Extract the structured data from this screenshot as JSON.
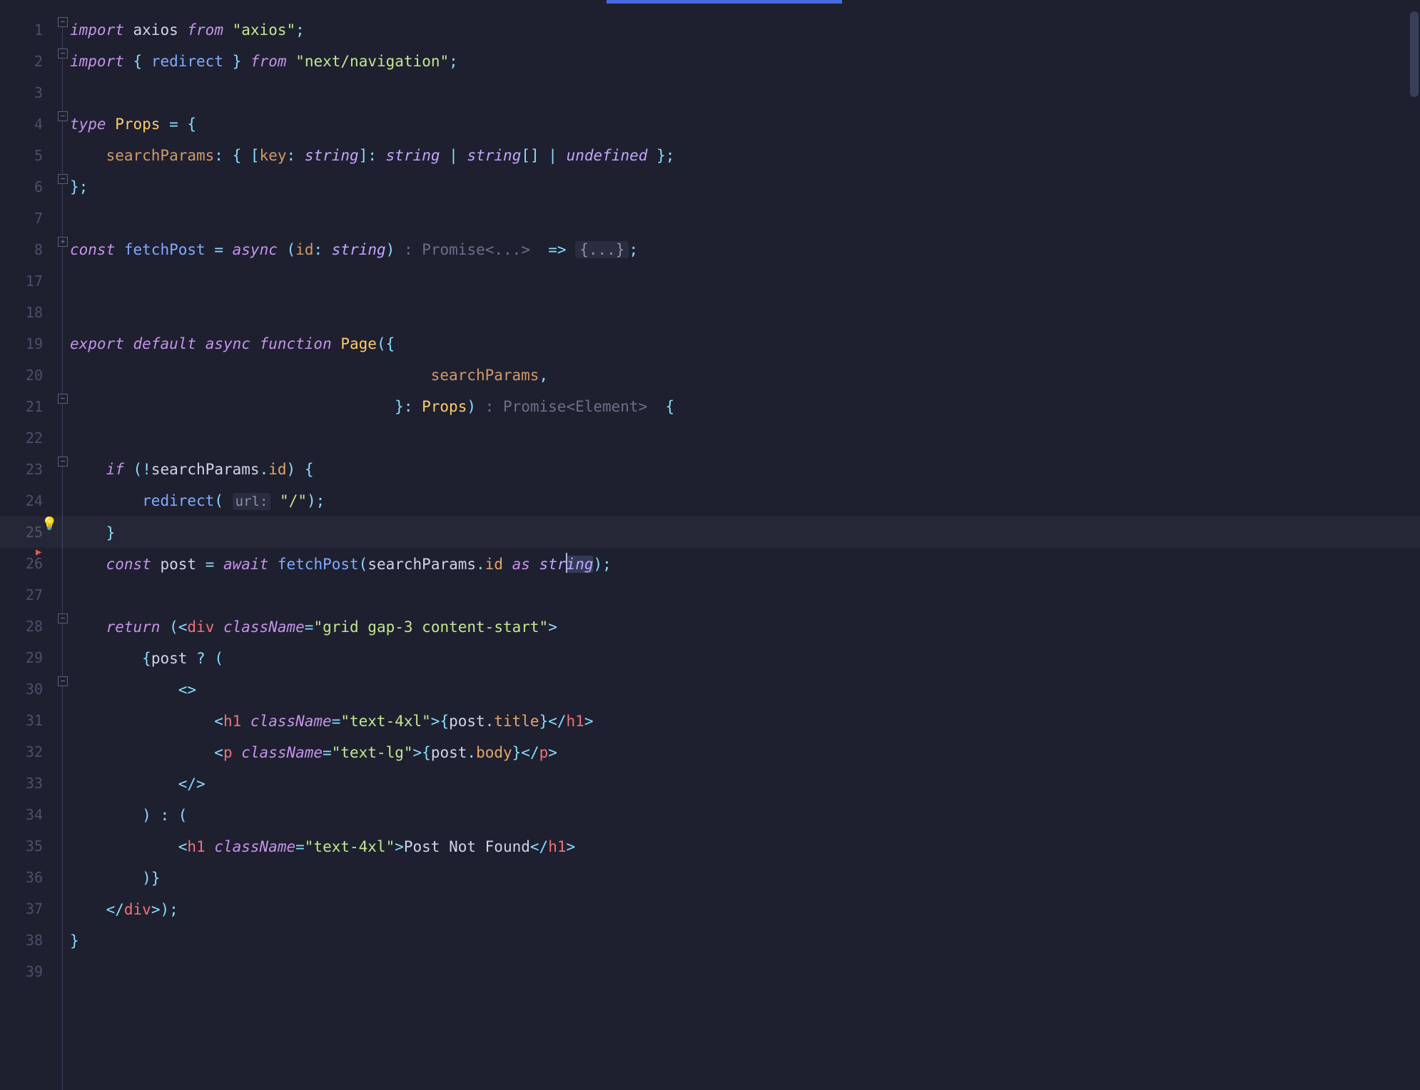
{
  "editor": {
    "language": "typescript-react",
    "line_numbers": [
      "1",
      "2",
      "3",
      "4",
      "5",
      "6",
      "7",
      "8",
      "17",
      "18",
      "19",
      "20",
      "21",
      "22",
      "23",
      "24",
      "25",
      "26",
      "27",
      "28",
      "29",
      "30",
      "31",
      "32",
      "33",
      "34",
      "35",
      "36",
      "37",
      "38",
      "39"
    ],
    "current_line_index": 16,
    "cursor_line": 26,
    "breakpoint_line": 26,
    "bulb_line": 25
  },
  "code": {
    "l1": {
      "import": "import",
      "axios": "axios",
      "from": "from",
      "mod": "\"axios\"",
      "semi": ";"
    },
    "l2": {
      "import": "import",
      "brace_o": "{",
      "redirect": "redirect",
      "brace_c": "}",
      "from": "from",
      "mod": "\"next/navigation\"",
      "semi": ";"
    },
    "l4": {
      "type": "type",
      "Props": "Props",
      "eq": "=",
      "brace_o": "{"
    },
    "l5": {
      "searchParams": "searchParams",
      "colon": ":",
      "brace_o": "{",
      "bracket_o": "[",
      "key": "key",
      "colon2": ":",
      "string1": "string",
      "bracket_c": "]",
      "colon3": ":",
      "string2": "string",
      "pipe1": "|",
      "string3": "string",
      "arr": "[]",
      "pipe2": "|",
      "undef": "undefined",
      "brace_c": "}",
      "semi": ";"
    },
    "l6": {
      "brace_c": "}",
      "semi": ";"
    },
    "l8": {
      "const": "const",
      "fetchPost": "fetchPost",
      "eq": "=",
      "async": "async",
      "paren_o": "(",
      "id": "id",
      "colon": ":",
      "string": "string",
      "paren_c": ")",
      "hint": ": Promise<...>",
      "arrow": "=>",
      "folded": "{...}",
      "semi": ";"
    },
    "l19": {
      "export": "export",
      "default": "default",
      "async": "async",
      "function": "function",
      "Page": "Page",
      "paren_o": "(",
      "brace_o": "{"
    },
    "l20": {
      "searchParams": "searchParams",
      "comma": ","
    },
    "l21": {
      "brace_c": "}",
      "colon": ":",
      "Props": "Props",
      "paren_c": ")",
      "hint": ": Promise<Element>",
      "brace_o": "{"
    },
    "l23": {
      "if": "if",
      "paren_o": "(",
      "not": "!",
      "searchParams": "searchParams",
      "dot": ".",
      "id": "id",
      "paren_c": ")",
      "brace_o": "{"
    },
    "l24": {
      "redirect": "redirect",
      "paren_o": "(",
      "hint": "url:",
      "str": "\"/\"",
      "paren_c": ")",
      "semi": ";"
    },
    "l25": {
      "brace_c": "}"
    },
    "l26": {
      "const": "const",
      "post": "post",
      "eq": "=",
      "await": "await",
      "fetchPost": "fetchPost",
      "paren_o": "(",
      "searchParams": "searchParams",
      "dot": ".",
      "id": "id",
      "as": "as",
      "string": "string",
      "paren_c": ")",
      "semi": ";"
    },
    "l28": {
      "return": "return",
      "paren_o": "(",
      "lt": "<",
      "div": "div",
      "className": "className",
      "eq": "=",
      "val": "\"grid gap-3 content-start\"",
      "gt": ">"
    },
    "l29": {
      "brace_o": "{",
      "post": "post",
      "q": "?",
      "paren_o": "("
    },
    "l30": {
      "frag_o": "<>"
    },
    "l31": {
      "lt": "<",
      "h1": "h1",
      "className": "className",
      "eq": "=",
      "val": "\"text-4xl\"",
      "gt": ">",
      "brace_o": "{",
      "post": "post",
      "dot": ".",
      "title": "title",
      "brace_c": "}",
      "lt2": "</",
      "h1_2": "h1",
      "gt2": ">"
    },
    "l32": {
      "lt": "<",
      "p": "p",
      "className": "className",
      "eq": "=",
      "val": "\"text-lg\"",
      "gt": ">",
      "brace_o": "{",
      "post": "post",
      "dot": ".",
      "body": "body",
      "brace_c": "}",
      "lt2": "</",
      "p2": "p",
      "gt2": ">"
    },
    "l33": {
      "frag_c": "</>"
    },
    "l34": {
      "paren_c": ")",
      "colon": ":",
      "paren_o": "("
    },
    "l35": {
      "lt": "<",
      "h1": "h1",
      "className": "className",
      "eq": "=",
      "val": "\"text-4xl\"",
      "gt": ">",
      "text": "Post Not Found",
      "lt2": "</",
      "h1_2": "h1",
      "gt2": ">"
    },
    "l36": {
      "paren_c": ")",
      "brace_c": "}"
    },
    "l37": {
      "lt": "</",
      "div": "div",
      "gt": ">",
      "paren_c": ")",
      "semi": ";"
    },
    "l38": {
      "brace_c": "}"
    }
  }
}
